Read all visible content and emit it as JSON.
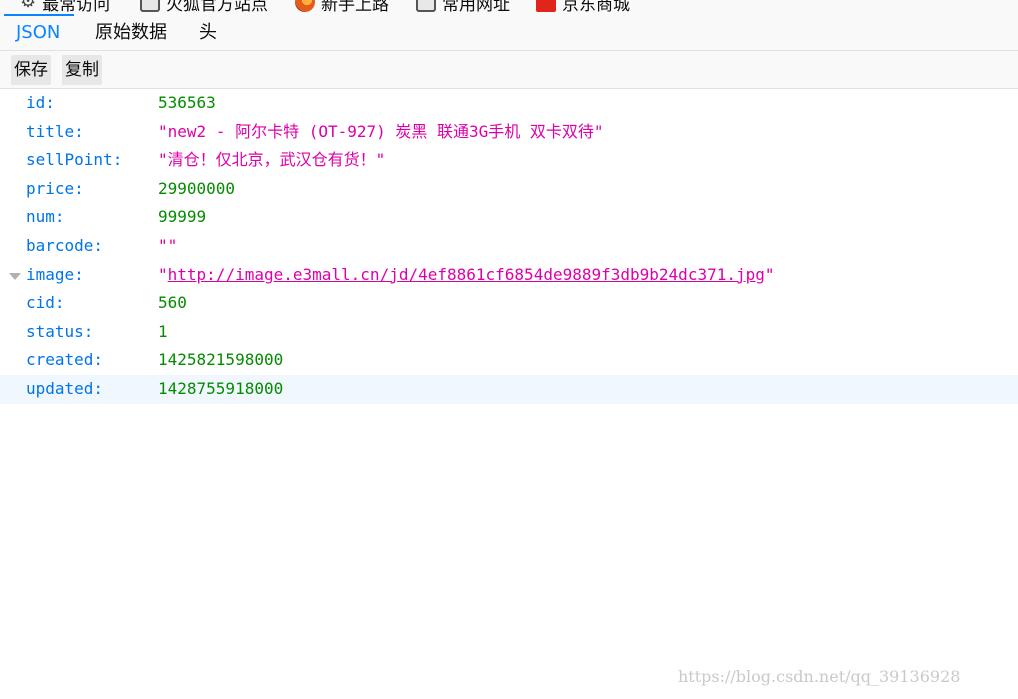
{
  "bookmarks": [
    {
      "label": "最常访问",
      "icon": "gear-icon"
    },
    {
      "label": "火狐官方站点",
      "icon": "folder-icon"
    },
    {
      "label": "新手上路",
      "icon": "firefox-icon"
    },
    {
      "label": "常用网址",
      "icon": "folder-icon"
    },
    {
      "label": "京东商城",
      "icon": "jd-icon"
    }
  ],
  "tabs": {
    "json": "JSON",
    "raw": "原始数据",
    "headers": "头",
    "active": "JSON"
  },
  "toolbar": {
    "save": "保存",
    "copy": "复制"
  },
  "json": {
    "id": {
      "key": "id:",
      "value": "536563"
    },
    "title": {
      "key": "title:",
      "value": "\"new2 - 阿尔卡特 (OT-927) 炭黑 联通3G手机 双卡双待\""
    },
    "sellPoint": {
      "key": "sellPoint:",
      "value": "\"清仓！仅北京，武汉仓有货！\""
    },
    "price": {
      "key": "price:",
      "value": "29900000"
    },
    "num": {
      "key": "num:",
      "value": "99999"
    },
    "barcode": {
      "key": "barcode:",
      "value": "\"\""
    },
    "image": {
      "key": "image:",
      "quote": "\"",
      "value": "http://image.e3mall.cn/jd/4ef8861cf6854de9889f3db9b24dc371.jpg"
    },
    "cid": {
      "key": "cid:",
      "value": "560"
    },
    "status": {
      "key": "status:",
      "value": "1"
    },
    "created": {
      "key": "created:",
      "value": "1425821598000"
    },
    "updated": {
      "key": "updated:",
      "value": "1428755918000"
    }
  },
  "colors": {
    "key": "#0074e8",
    "number": "#058b00",
    "string": "#dd00a9",
    "accent": "#0a84ff"
  },
  "watermark": "https://blog.csdn.net/qq_39136928"
}
